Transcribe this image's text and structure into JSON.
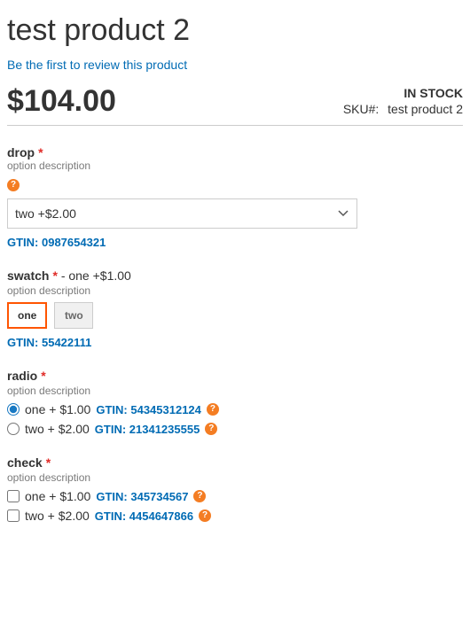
{
  "header": {
    "title": "test product 2",
    "review_link": "Be the first to review this product"
  },
  "price": "$104.00",
  "stock": {
    "label": "IN STOCK",
    "sku_prefix": "SKU#:",
    "sku_value": "test product 2"
  },
  "options": {
    "drop": {
      "label": "drop",
      "desc": "option description",
      "selected": "two +$2.00",
      "gtin": "GTIN: 0987654321"
    },
    "swatch": {
      "label": "swatch",
      "suffix": "- one +$1.00",
      "desc": "option description",
      "items": [
        {
          "label": "one",
          "selected": true
        },
        {
          "label": "two",
          "selected": false
        }
      ],
      "gtin": "GTIN: 55422111"
    },
    "radio": {
      "label": "radio",
      "desc": "option description",
      "items": [
        {
          "label": "one + $1.00",
          "gtin": "GTIN: 54345312124",
          "checked": true
        },
        {
          "label": "two + $2.00",
          "gtin": "GTIN: 21341235555",
          "checked": false
        }
      ]
    },
    "check": {
      "label": "check",
      "desc": "option description",
      "items": [
        {
          "label": "one + $1.00",
          "gtin": "GTIN: 345734567"
        },
        {
          "label": "two + $2.00",
          "gtin": "GTIN: 4454647866"
        }
      ]
    }
  }
}
